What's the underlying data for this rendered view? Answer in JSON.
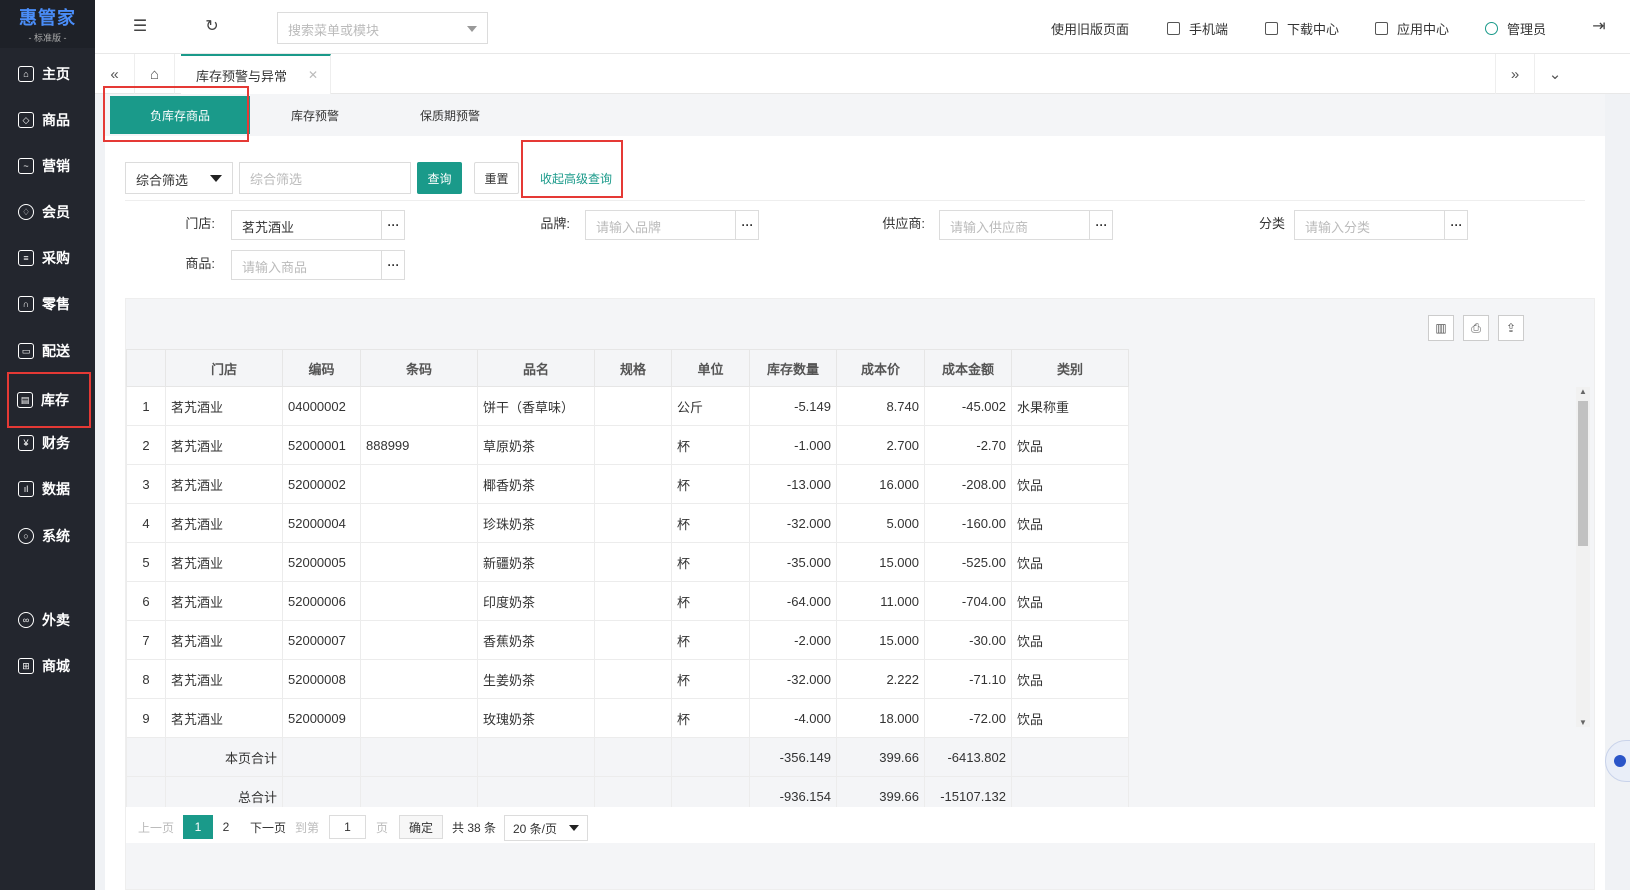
{
  "sidebar": {
    "logo": "惠管家",
    "logo_sub": "- 标准版 -",
    "items": [
      {
        "label": "主页",
        "icon": "home-icon"
      },
      {
        "label": "商品",
        "icon": "cube-icon"
      },
      {
        "label": "营销",
        "icon": "chart-icon"
      },
      {
        "label": "会员",
        "icon": "diamond-icon"
      },
      {
        "label": "采购",
        "icon": "cart-icon"
      },
      {
        "label": "零售",
        "icon": "bag-icon"
      },
      {
        "label": "配送",
        "icon": "truck-icon"
      },
      {
        "label": "库存",
        "icon": "inventory-icon"
      },
      {
        "label": "财务",
        "icon": "yen-icon"
      },
      {
        "label": "数据",
        "icon": "bar-chart-icon"
      },
      {
        "label": "系统",
        "icon": "settings-icon"
      },
      {
        "label": "外卖",
        "icon": "bike-icon"
      },
      {
        "label": "商城",
        "icon": "store-icon"
      }
    ]
  },
  "header": {
    "search_placeholder": "搜索菜单或模块",
    "links": {
      "old_page": "使用旧版页面",
      "mobile": "手机端",
      "download": "下载中心",
      "apps": "应用中心",
      "user": "管理员"
    }
  },
  "tabbar": {
    "active_tab": "库存预警与异常"
  },
  "subtabs": {
    "negative": "负库存商品",
    "warning": "库存预警",
    "expiry": "保质期预警"
  },
  "filters": {
    "combo_select": "综合筛选",
    "combo_placeholder": "综合筛选",
    "query_button": "查询",
    "reset_button": "重置",
    "advanced_link": "收起高级查询",
    "store_label": "门店:",
    "store_value": "茗艽酒业",
    "brand_label": "品牌:",
    "brand_placeholder": "请输入品牌",
    "supplier_label": "供应商:",
    "supplier_placeholder": "请输入供应商",
    "category_label": "分类",
    "category_placeholder": "请输入分类",
    "product_label": "商品:",
    "product_placeholder": "请输入商品",
    "dots": "···"
  },
  "table": {
    "columns": [
      "",
      "门店",
      "编码",
      "条码",
      "品名",
      "规格",
      "单位",
      "库存数量",
      "成本价",
      "成本金额",
      "类别"
    ],
    "rows": [
      [
        "1",
        "茗艽酒业",
        "04000002",
        "",
        "饼干（香草味）",
        "",
        "公斤",
        "-5.149",
        "8.740",
        "-45.002",
        "水果称重"
      ],
      [
        "2",
        "茗艽酒业",
        "52000001",
        "888999",
        "草原奶茶",
        "",
        "杯",
        "-1.000",
        "2.700",
        "-2.70",
        "饮品"
      ],
      [
        "3",
        "茗艽酒业",
        "52000002",
        "",
        "椰香奶茶",
        "",
        "杯",
        "-13.000",
        "16.000",
        "-208.00",
        "饮品"
      ],
      [
        "4",
        "茗艽酒业",
        "52000004",
        "",
        "珍珠奶茶",
        "",
        "杯",
        "-32.000",
        "5.000",
        "-160.00",
        "饮品"
      ],
      [
        "5",
        "茗艽酒业",
        "52000005",
        "",
        "新疆奶茶",
        "",
        "杯",
        "-35.000",
        "15.000",
        "-525.00",
        "饮品"
      ],
      [
        "6",
        "茗艽酒业",
        "52000006",
        "",
        "印度奶茶",
        "",
        "杯",
        "-64.000",
        "11.000",
        "-704.00",
        "饮品"
      ],
      [
        "7",
        "茗艽酒业",
        "52000007",
        "",
        "香蕉奶茶",
        "",
        "杯",
        "-2.000",
        "15.000",
        "-30.00",
        "饮品"
      ],
      [
        "8",
        "茗艽酒业",
        "52000008",
        "",
        "生姜奶茶",
        "",
        "杯",
        "-32.000",
        "2.222",
        "-71.10",
        "饮品"
      ],
      [
        "9",
        "茗艽酒业",
        "52000009",
        "",
        "玫瑰奶茶",
        "",
        "杯",
        "-4.000",
        "18.000",
        "-72.00",
        "饮品"
      ]
    ],
    "page_total": {
      "label": "本页合计",
      "qty": "-356.149",
      "price": "399.66",
      "amount": "-6413.802"
    },
    "grand_total": {
      "label": "总合计",
      "qty": "-936.154",
      "price": "399.66",
      "amount": "-15107.132"
    }
  },
  "pager": {
    "prev": "上一页",
    "page1": "1",
    "page2": "2",
    "next": "下一页",
    "goto": "到第",
    "goto_value": "1",
    "page_unit": "页",
    "confirm": "确定",
    "total": "共 38 条",
    "page_size": "20 条/页"
  },
  "colors": {
    "accent": "#1a9a8a",
    "sidebar_bg": "#23262e",
    "highlight": "#e53935"
  }
}
